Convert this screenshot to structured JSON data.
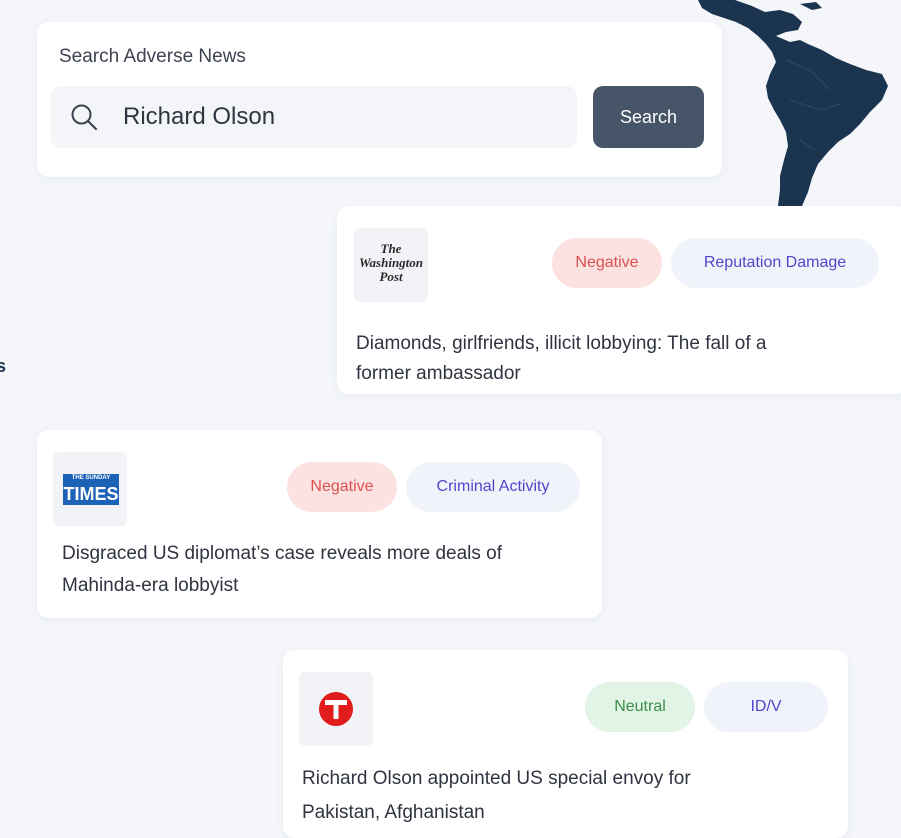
{
  "search": {
    "title": "Search Adverse News",
    "value": "Richard Olson",
    "button_label": "Search"
  },
  "results": [
    {
      "source": "The Washington Post",
      "logo_lines": [
        "The",
        "Washington",
        "Post"
      ],
      "sentiment": "Negative",
      "category": "Reputation Damage",
      "headline_line1": "Diamonds, girlfriends, illicit lobbying: The fall of a",
      "headline_line2": "former ambassador"
    },
    {
      "source": "The Sunday Times",
      "logo_small": "THE SUNDAY",
      "logo_big": "TIMES",
      "sentiment": "Negative",
      "category": "Criminal Activity",
      "headline_line1": "Disgraced US diplomat’s case reveals more deals of",
      "headline_line2": "Mahinda-era lobbyist"
    },
    {
      "source": "The Express Tribune",
      "logo_letter": "T",
      "sentiment": "Neutral",
      "category": "ID/V",
      "headline_line1": "Richard Olson appointed US special envoy for",
      "headline_line2": "Pakistan, Afghanistan"
    }
  ],
  "edge_text": "s",
  "colors": {
    "accent_button": "#475569",
    "negative_bg": "#fde2e2",
    "negative_text": "#dc5050",
    "neutral_bg": "#e2f4e5",
    "neutral_text": "#3b8f4a",
    "category_text": "#5145cd",
    "map": "#1b3550"
  },
  "icons": [
    "search-icon",
    "south-america-map-icon"
  ]
}
